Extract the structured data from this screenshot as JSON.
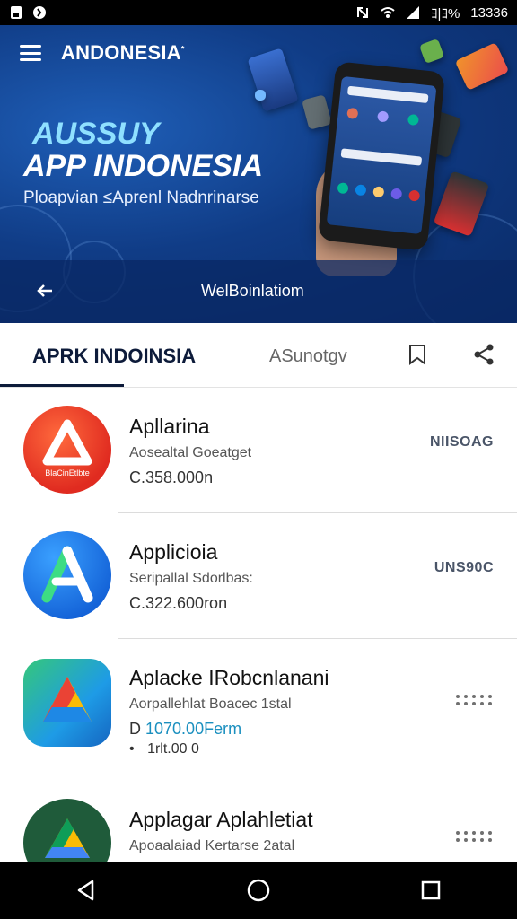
{
  "status_bar": {
    "battery": "ﾖ|ﾖ%",
    "time": "13336",
    "icons": [
      "sd-card-icon",
      "notification-icon",
      "nfc-icon",
      "wifi-icon",
      "signal-icon"
    ]
  },
  "header": {
    "brand": "ANDONESIA",
    "brand_mark": "*",
    "menu_icon": "hamburger-menu-icon"
  },
  "hero": {
    "title_line1": "AUSSUY",
    "title_line2": "APP INDONESIA",
    "subtitle": "Ploapvian ≤Aprenl Nadnrinarse",
    "link_text": "WelBoinlatiom",
    "colors": {
      "bg": "#103c86",
      "title_accent": "#8fe0ff"
    }
  },
  "tabs": {
    "active": "APRK INDOINSIA",
    "secondary": "ASunotgv",
    "icons": [
      "bookmark-icon",
      "share-icon"
    ]
  },
  "apps": [
    {
      "name": "Apllarina",
      "developer": "Aosealtal Goeatget",
      "size": "C.358.000n",
      "action": "NIISOAG",
      "icon": "red-triangle-app-icon",
      "icon_label": "BlaCinEtlbte"
    },
    {
      "name": "Applicioia",
      "developer": "Seripallal Sdorlbas:",
      "size": "C.322.600ron",
      "action": "UNS90C",
      "icon": "blue-a-app-icon"
    },
    {
      "name": "Aplacke IRobcnlanani",
      "developer": "Aorpallehlat Boacec 1stal",
      "size": "1070.00Ferm",
      "size_prefix": "D",
      "extra": "1rlt.00 0",
      "extra_prefix": "•",
      "action": "more-options",
      "icon": "gradient-a-app-icon"
    },
    {
      "name": "Applagar Aplahletiat",
      "developer": "Apoaalaiad Kertarse 2atal",
      "size": "",
      "action": "more-options",
      "icon": "google-drive-app-icon"
    }
  ],
  "nav": {
    "buttons": [
      "back-icon",
      "home-icon",
      "recents-icon"
    ]
  }
}
